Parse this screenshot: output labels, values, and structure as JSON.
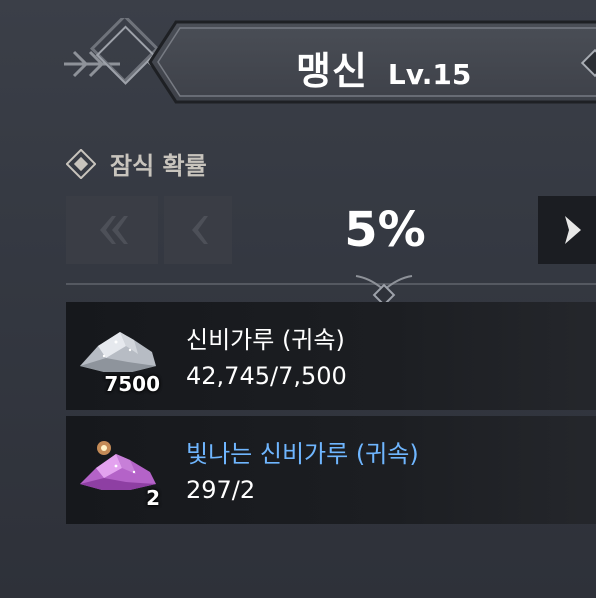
{
  "header": {
    "name": "맹신",
    "level": "Lv.15"
  },
  "section": {
    "label": "잠식 확률"
  },
  "rate": {
    "value": "5%",
    "first_icon": "double-chevron-left-icon",
    "prev_icon": "chevron-left-icon",
    "next_icon": "chevron-right-icon"
  },
  "materials": [
    {
      "name": "신비가루 (귀속)",
      "count": "42,745/7,500",
      "required": "7500",
      "icon": "mystic-powder-icon",
      "name_color": "#ffffff"
    },
    {
      "name": "빛나는 신비가루 (귀속)",
      "count": "297/2",
      "required": "2",
      "icon": "shining-mystic-powder-icon",
      "name_color": "#6fb6ff"
    }
  ],
  "colors": {
    "background": "#363a43",
    "row_background": "#1a1c20",
    "highlight_name": "#6fb6ff",
    "section_label": "#c8c4bd"
  }
}
